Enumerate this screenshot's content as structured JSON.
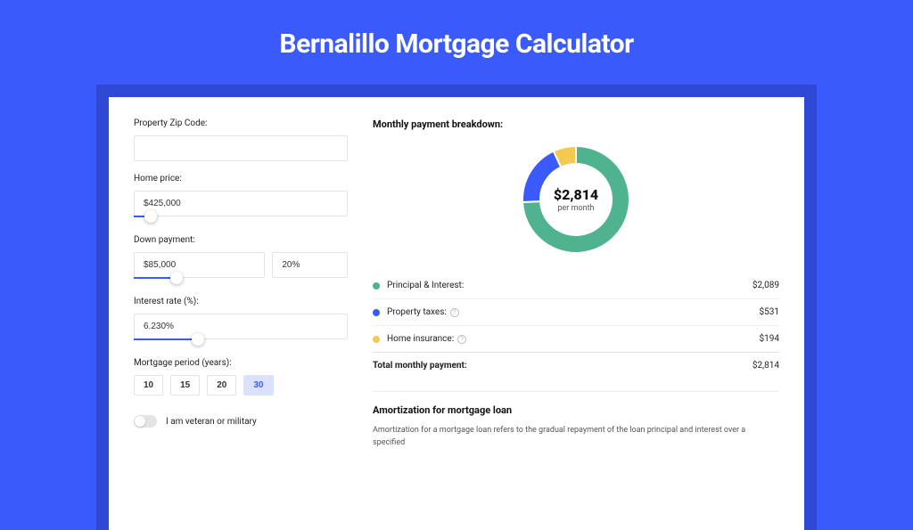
{
  "title": "Bernalillo Mortgage Calculator",
  "form": {
    "zip_label": "Property Zip Code:",
    "zip_value": "",
    "price_label": "Home price:",
    "price_value": "$425,000",
    "price_slider_pct": 8,
    "down_label": "Down payment:",
    "down_value": "$85,000",
    "down_pct_value": "20%",
    "down_slider_pct": 20,
    "rate_label": "Interest rate (%):",
    "rate_value": "6.230%",
    "rate_slider_pct": 30,
    "period_label": "Mortgage period (years):",
    "periods": [
      "10",
      "15",
      "20",
      "30"
    ],
    "period_active": "30",
    "veteran_label": "I am veteran or military"
  },
  "breakdown": {
    "title": "Monthly payment breakdown:",
    "center_value": "$2,814",
    "center_sub": "per month",
    "items": [
      {
        "label": "Principal & Interest:",
        "amount": "$2,089",
        "color": "#4fb38f",
        "info": false,
        "pct": 74.2
      },
      {
        "label": "Property taxes:",
        "amount": "$531",
        "color": "#3b5afc",
        "info": true,
        "pct": 18.9
      },
      {
        "label": "Home insurance:",
        "amount": "$194",
        "color": "#f3c94f",
        "info": true,
        "pct": 6.9
      }
    ],
    "total_label": "Total monthly payment:",
    "total_amount": "$2,814"
  },
  "amort": {
    "title": "Amortization for mortgage loan",
    "text": "Amortization for a mortgage loan refers to the gradual repayment of the loan principal and interest over a specified"
  },
  "chart_data": {
    "type": "pie",
    "title": "Monthly payment breakdown",
    "series": [
      {
        "name": "Principal & Interest",
        "value": 2089
      },
      {
        "name": "Property taxes",
        "value": 531
      },
      {
        "name": "Home insurance",
        "value": 194
      }
    ],
    "total": 2814,
    "unit": "USD/month"
  }
}
